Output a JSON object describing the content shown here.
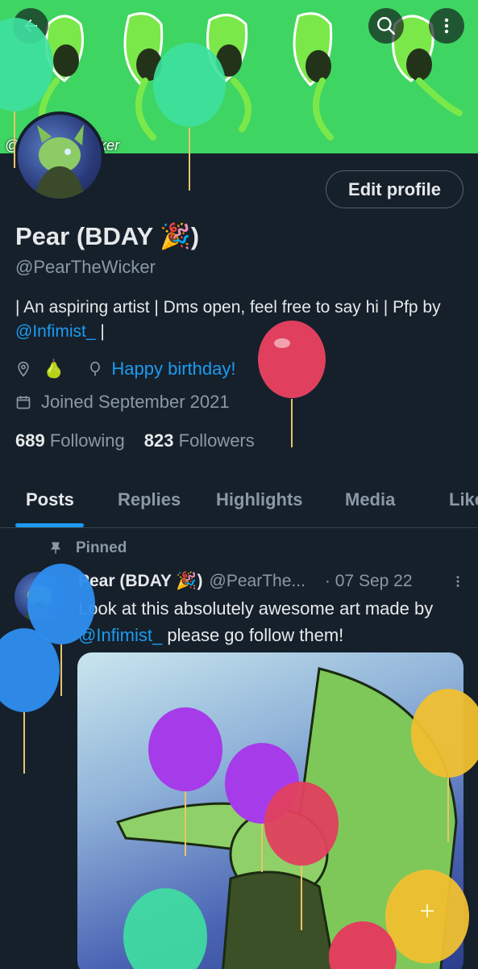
{
  "header": {
    "back_icon": "back-arrow-icon",
    "search_icon": "search-icon",
    "more_icon": "more-vertical-icon",
    "banner_handle_text": "@PearTheWicker"
  },
  "profile": {
    "edit_label": "Edit profile",
    "display_name": "Pear (BDAY 🎉)",
    "handle": "@PearTheWicker",
    "bio_text": "| An aspiring artist | Dms open, feel free to say hi | Pfp by ",
    "bio_link": "@Infimist_",
    "bio_end": " |",
    "location": "🍐",
    "birthday": "Happy birthday!",
    "joined": "Joined September 2021",
    "following_count": "689",
    "following_label": "Following",
    "followers_count": "823",
    "followers_label": "Followers"
  },
  "tabs": [
    {
      "label": "Posts"
    },
    {
      "label": "Replies"
    },
    {
      "label": "Highlights"
    },
    {
      "label": "Media"
    },
    {
      "label": "Likes"
    }
  ],
  "post": {
    "pinned_label": "Pinned",
    "author_name": "Pear (BDAY 🎉)",
    "author_handle": "@PearThe...",
    "date": "· 07 Sep 22",
    "text_before": "Look at this absolutely awesome art made by ",
    "text_link": "@Infimist_",
    "text_after": " please go follow them!"
  },
  "colors": {
    "background": "#15202b",
    "accent": "#1d9bf0",
    "muted": "#8b98a5",
    "banner": "#3ddc5f"
  }
}
